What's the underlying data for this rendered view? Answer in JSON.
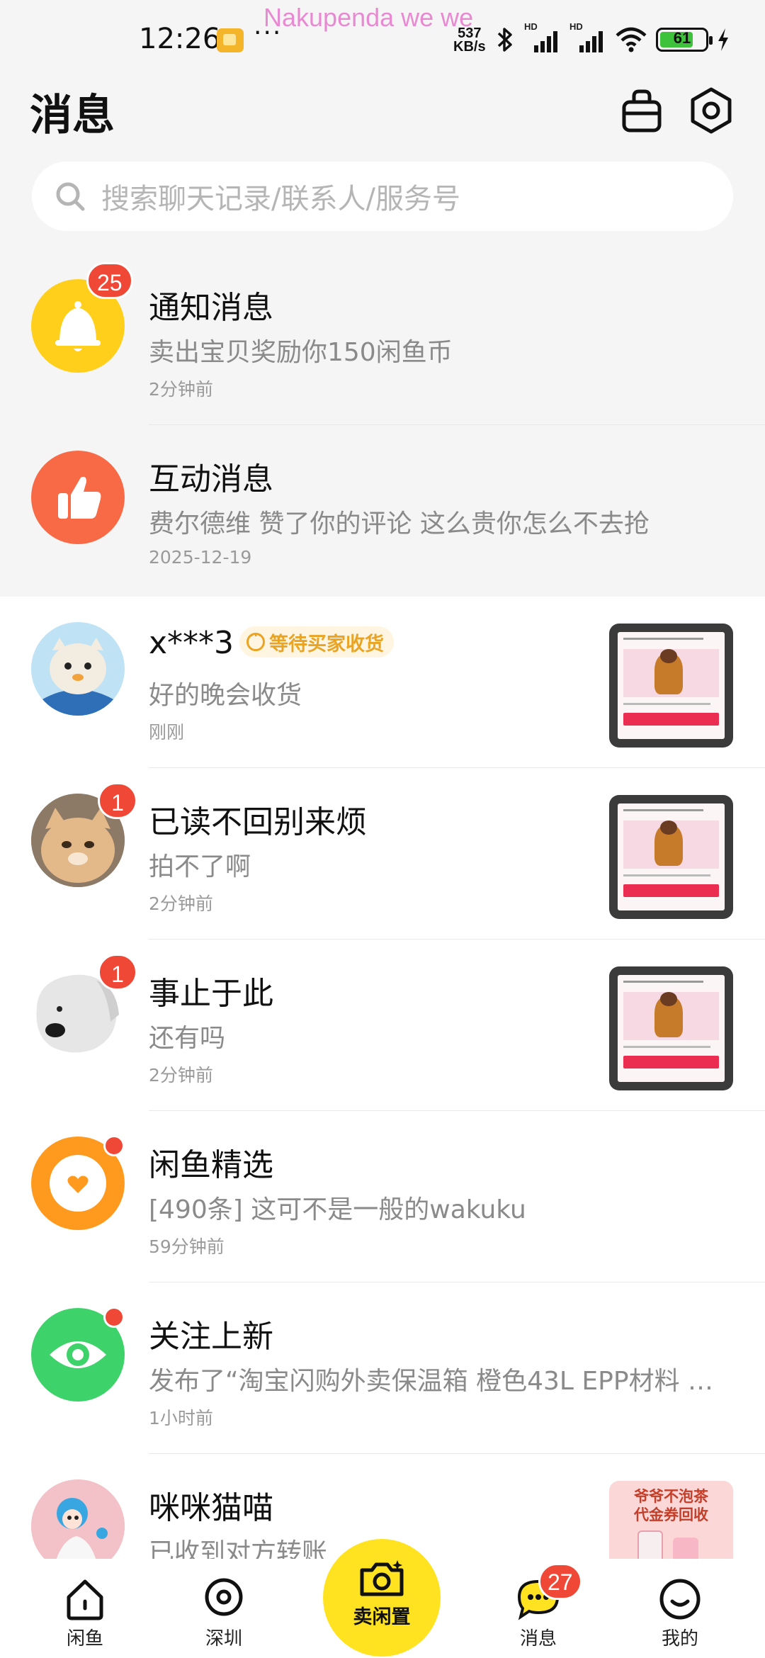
{
  "status_bar": {
    "time": "12:26",
    "more": "···",
    "watermark": "Nakupenda we we",
    "net_speed_value": "537",
    "net_speed_unit": "KB/s",
    "hd1": "HD",
    "hd2": "HD",
    "battery": "61",
    "icons": [
      "notification-app-icon",
      "bluetooth-icon",
      "signal-icon",
      "wifi-icon",
      "battery-icon",
      "charging-icon"
    ]
  },
  "header": {
    "title": "消息",
    "icons": [
      "bag-icon",
      "settings-icon"
    ]
  },
  "search": {
    "placeholder": "搜索聊天记录/联系人/服务号"
  },
  "messages": [
    {
      "title": "通知消息",
      "subtitle": "卖出宝贝奖励你150闲鱼币",
      "time": "2分钟前",
      "badge": "25",
      "avatar": "bell-icon",
      "accent": "#ffcf1c"
    },
    {
      "title": "互动消息",
      "subtitle": "费尔德维 赞了你的评论 这么贵你怎么不去抢",
      "time": "2025-12-19",
      "avatar": "thumbs-up-icon",
      "accent": "#f86a45"
    },
    {
      "title": "x***3",
      "status_tag": "等待买家收货",
      "subtitle": "好的晚会收货",
      "time": "刚刚",
      "avatar": "user-avatar"
    },
    {
      "title": "已读不回别来烦",
      "subtitle": "拍不了啊",
      "time": "2分钟前",
      "badge": "1",
      "avatar": "user-avatar"
    },
    {
      "title": "事止于此",
      "subtitle": "还有吗",
      "time": "2分钟前",
      "badge": "1",
      "avatar": "user-avatar"
    },
    {
      "title": "闲鱼精选",
      "subtitle": "[490条] 这可不是一般的wakuku",
      "time": "59分钟前",
      "avatar": "heart-icon",
      "accent": "#ff9a1f"
    },
    {
      "title": "关注上新",
      "subtitle": "发布了“淘宝闪购外卖保温箱 橙色43L EPP材料 加厚 ...",
      "time": "1小时前",
      "avatar": "eye-icon",
      "accent": "#3ed36a"
    },
    {
      "title": "咪咪猫喵",
      "subtitle": "已收到对方转账",
      "avatar": "user-avatar"
    }
  ],
  "promo": {
    "line1": "爷爷不泡茶",
    "line2": "代金券回收"
  },
  "bottom_nav": {
    "items": [
      {
        "label": "闲鱼",
        "icon": "home-icon"
      },
      {
        "label": "深圳",
        "icon": "location-icon"
      },
      {
        "label": "卖闲置",
        "icon": "camera-icon"
      },
      {
        "label": "消息",
        "icon": "chat-icon",
        "badge": "27"
      },
      {
        "label": "我的",
        "icon": "profile-icon"
      }
    ]
  },
  "colors": {
    "brand_yellow": "#ffe320",
    "badge_red": "#ef4836",
    "status_orange": "#e9a424",
    "watermark_pink": "#e88ad2"
  }
}
